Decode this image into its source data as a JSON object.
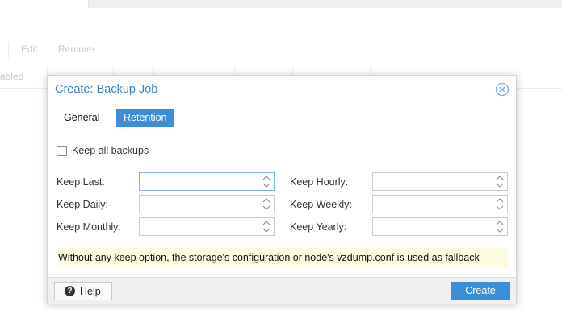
{
  "background": {
    "toolbar": {
      "edit_label": "Edit",
      "remove_label": "Remove"
    },
    "header_first_col": "abled"
  },
  "dialog": {
    "title": "Create: Backup Job",
    "tabs": [
      {
        "label": "General",
        "active": false
      },
      {
        "label": "Retention",
        "active": true
      }
    ],
    "keep_all": {
      "label": "Keep all backups",
      "checked": false
    },
    "fields": {
      "keep_last": {
        "label": "Keep Last:",
        "value": ""
      },
      "keep_daily": {
        "label": "Keep Daily:",
        "value": ""
      },
      "keep_monthly": {
        "label": "Keep Monthly:",
        "value": ""
      },
      "keep_hourly": {
        "label": "Keep Hourly:",
        "value": ""
      },
      "keep_weekly": {
        "label": "Keep Weekly:",
        "value": ""
      },
      "keep_yearly": {
        "label": "Keep Yearly:",
        "value": ""
      }
    },
    "info": "Without any keep option, the storage's configuration or node's vzdump.conf is used as fallback",
    "footer": {
      "help_label": "Help",
      "create_label": "Create"
    }
  },
  "colors": {
    "accent": "#3c8ed7",
    "title": "#3b7dbf",
    "info_bg": "#fdfbe0"
  }
}
